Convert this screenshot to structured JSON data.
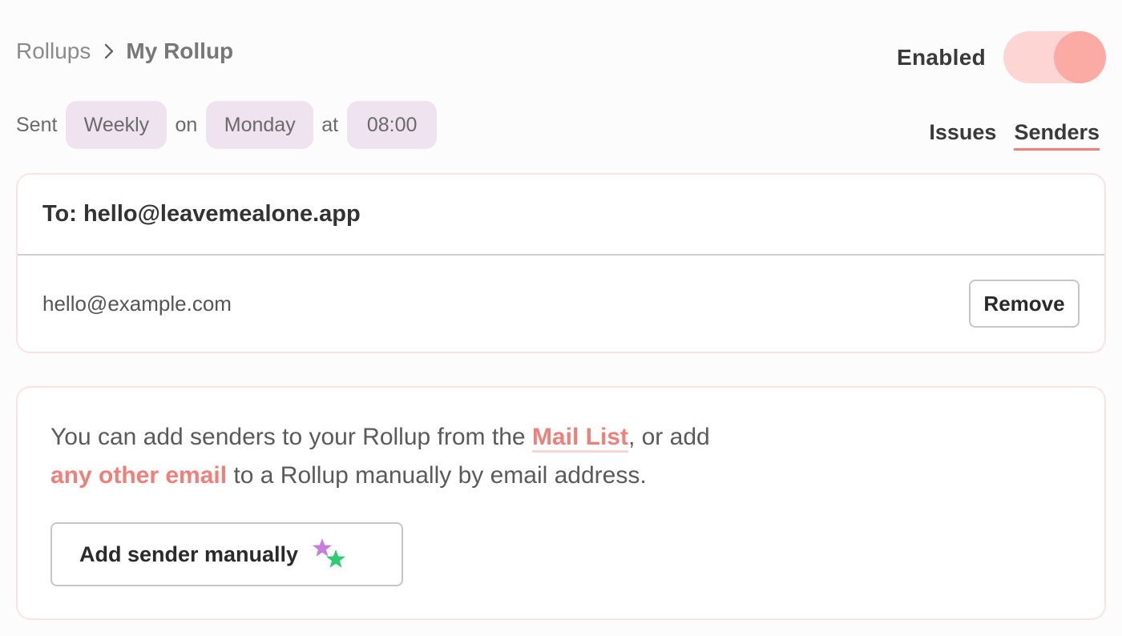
{
  "breadcrumb": {
    "root": "Rollups",
    "current": "My Rollup"
  },
  "toggle": {
    "label": "Enabled",
    "state": "on",
    "color_track": "#fdd6d3",
    "color_knob": "#fcaaa4"
  },
  "schedule": {
    "sent_word": "Sent",
    "frequency": "Weekly",
    "on_word": "on",
    "day": "Monday",
    "at_word": "at",
    "time": "08:00"
  },
  "tabs": [
    {
      "label": "Issues",
      "active": false
    },
    {
      "label": "Senders",
      "active": true
    }
  ],
  "recipient": {
    "to_label": "To:",
    "address": "hello@leavemealone.app",
    "senders": [
      {
        "email": "hello@example.com",
        "action": "Remove"
      }
    ]
  },
  "info": {
    "part1": "You can add senders to your Rollup from the ",
    "mail_list_link": "Mail List",
    "part2": ", or add",
    "other_email_link": "any other email",
    "part3": " to a Rollup manually by email address.",
    "add_button": "Add sender manually"
  },
  "colors": {
    "accent": "#f07f7a",
    "pill_bg": "#eee3ee",
    "star_purple": "#c77ce0",
    "star_green": "#2ecc71"
  },
  "icons": {
    "separator": "chevron-right-icon",
    "sparkle": "sparkle-stars-icon"
  }
}
